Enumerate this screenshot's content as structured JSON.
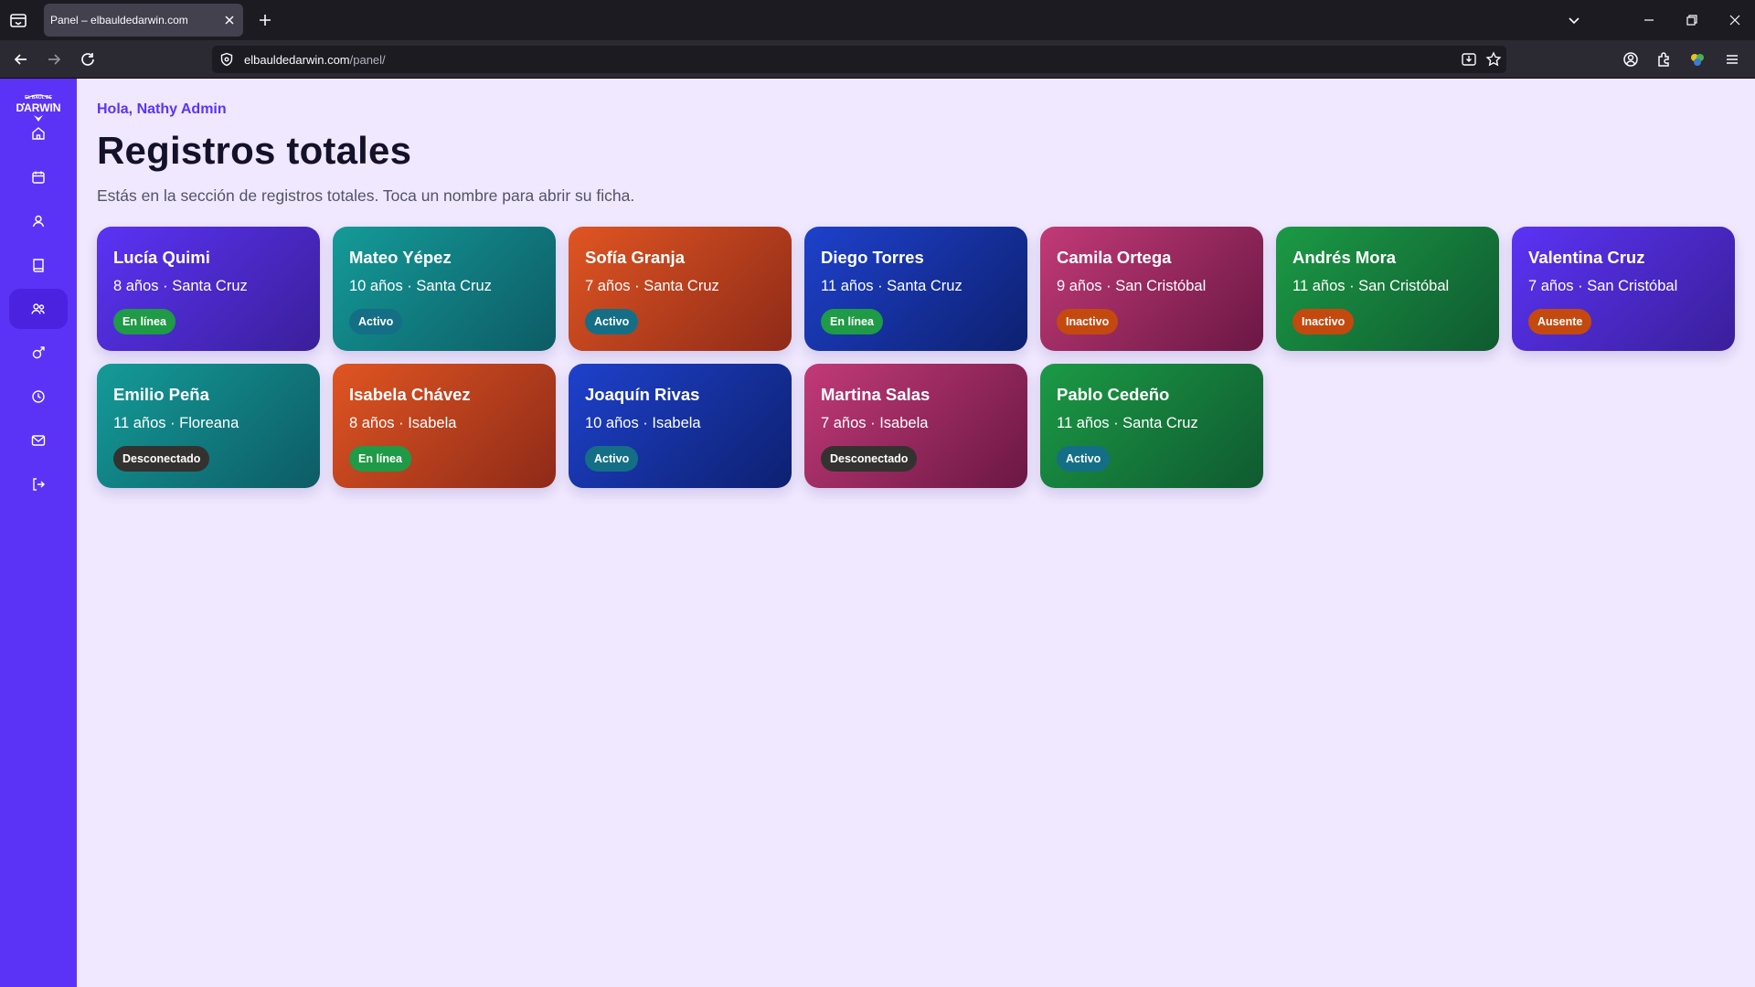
{
  "browser": {
    "tab_title": "Panel – elbauldedarwin.com",
    "url_host": "elbauldedarwin.com",
    "url_path": "/panel/"
  },
  "sidebar": {
    "logo_text": "EL BAÚL DE DARWIN",
    "items": [
      {
        "icon": "home-icon"
      },
      {
        "icon": "calendar-icon"
      },
      {
        "icon": "user-icon"
      },
      {
        "icon": "book-icon"
      },
      {
        "icon": "users-icon",
        "active": true
      },
      {
        "icon": "gender-icon"
      },
      {
        "icon": "clock-icon"
      },
      {
        "icon": "mail-icon"
      },
      {
        "icon": "logout-icon"
      }
    ]
  },
  "header": {
    "greeting": "Hola, Nathy Admin",
    "title": "Registros totales",
    "subtitle": "Estás en la sección de registros totales. Toca un nombre para abrir su ficha."
  },
  "cards": [
    {
      "name": "Lucía Quimi",
      "meta": "8 años · Santa Cruz",
      "status": "En línea",
      "theme": "purple",
      "badge": "green"
    },
    {
      "name": "Mateo Yépez",
      "meta": "10 años · Santa Cruz",
      "status": "Activo",
      "theme": "teal",
      "badge": "teal"
    },
    {
      "name": "Sofía Granja",
      "meta": "7 años · Santa Cruz",
      "status": "Activo",
      "theme": "orange",
      "badge": "teal"
    },
    {
      "name": "Diego Torres",
      "meta": "11 años · Santa Cruz",
      "status": "En línea",
      "theme": "blue",
      "badge": "green"
    },
    {
      "name": "Camila Ortega",
      "meta": "9 años · San Cristóbal",
      "status": "Inactivo",
      "theme": "pink",
      "badge": "orange"
    },
    {
      "name": "Andrés Mora",
      "meta": "11 años · San Cristóbal",
      "status": "Inactivo",
      "theme": "green",
      "badge": "orange"
    },
    {
      "name": "Valentina Cruz",
      "meta": "7 años · San Cristóbal",
      "status": "Ausente",
      "theme": "purple",
      "badge": "orange"
    },
    {
      "name": "Emilio Peña",
      "meta": "11 años · Floreana",
      "status": "Desconectado",
      "theme": "teal",
      "badge": "dark"
    },
    {
      "name": "Isabela Chávez",
      "meta": "8 años · Isabela",
      "status": "En línea",
      "theme": "orange",
      "badge": "green"
    },
    {
      "name": "Joaquín Rivas",
      "meta": "10 años · Isabela",
      "status": "Activo",
      "theme": "blue",
      "badge": "teal"
    },
    {
      "name": "Martina Salas",
      "meta": "7 años · Isabela",
      "status": "Desconectado",
      "theme": "pink",
      "badge": "dark"
    },
    {
      "name": "Pablo Cedeño",
      "meta": "11 años · Santa Cruz",
      "status": "Activo",
      "theme": "green",
      "badge": "teal"
    }
  ]
}
